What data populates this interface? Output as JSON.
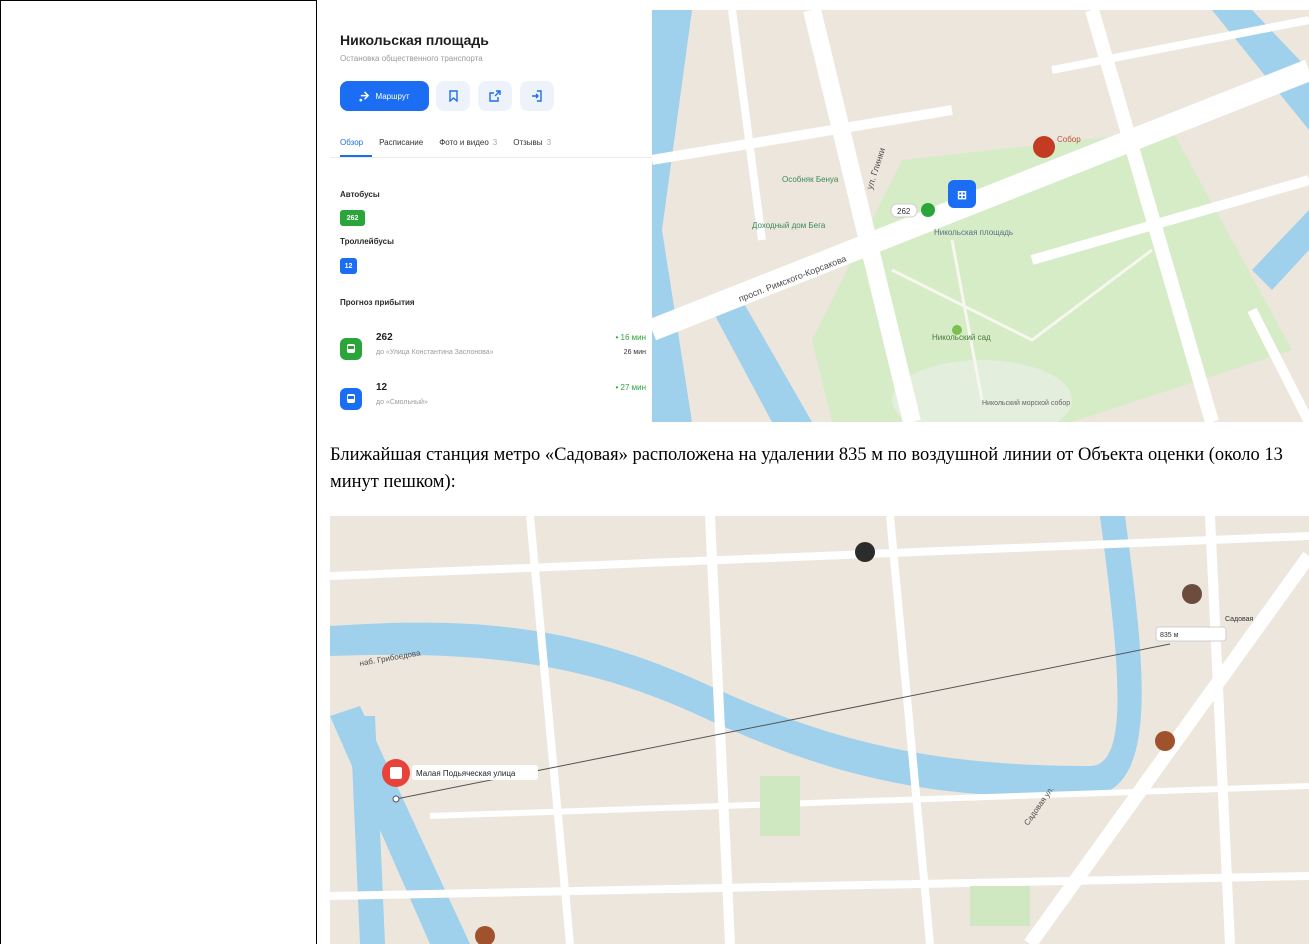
{
  "stop_card": {
    "title": "Никольская площадь",
    "subtitle": "Остановка общественного транспорта",
    "route_button": "Маршрут",
    "tabs": [
      {
        "label": "Обзор",
        "count": ""
      },
      {
        "label": "Расписание",
        "count": ""
      },
      {
        "label": "Фото и видео",
        "count": "3"
      },
      {
        "label": "Отзывы",
        "count": "3"
      }
    ],
    "buses_heading": "Автобусы",
    "bus_route": "262",
    "trolleybus_heading": "Троллейбусы",
    "trolleybus_route": "12",
    "forecast_heading": "Прогноз прибытия",
    "arrivals": [
      {
        "route": "262",
        "direction": "до «Улица Константина Заслонова»",
        "eta": "• 16 мин",
        "next": "26 мин",
        "color": "#2aa53a"
      },
      {
        "route": "12",
        "direction": "до «Смольный»",
        "eta": "• 27 мин",
        "next": "",
        "color": "#1b6ef3"
      }
    ]
  },
  "map_top": {
    "labels": {
      "street_1": "ул. Глинки",
      "avenue": "просп. Римского-Корсакова",
      "stop_name": "Никольская площадь",
      "stop_badge": "262",
      "garden": "Никольский сад",
      "church": "Собор",
      "poi_1": "Особняк Бенуа",
      "poi_2": "Доходный дом Бега",
      "poi_3": "Никольский морской собор"
    },
    "colors": {
      "water": "#9fd0ec",
      "park": "#d5ecc7",
      "block": "#ece6dd",
      "road": "#ffffff",
      "transit": "#1b6ef3"
    }
  },
  "paragraph": "Ближайшая станция метро «Садовая» расположена на удалении 835 м по воздушной линии от Объекта оценки (около 13 минут пешком):",
  "map_bottom": {
    "labels": {
      "object": "Малая Подьяческая улица",
      "street": "Садовая ул.",
      "distance": "835 м",
      "station": "Садовая",
      "canal": "наб. Грибоедова"
    },
    "colors": {
      "water": "#9fd0ec",
      "pin": "#e8423a",
      "line": "#555555"
    }
  }
}
